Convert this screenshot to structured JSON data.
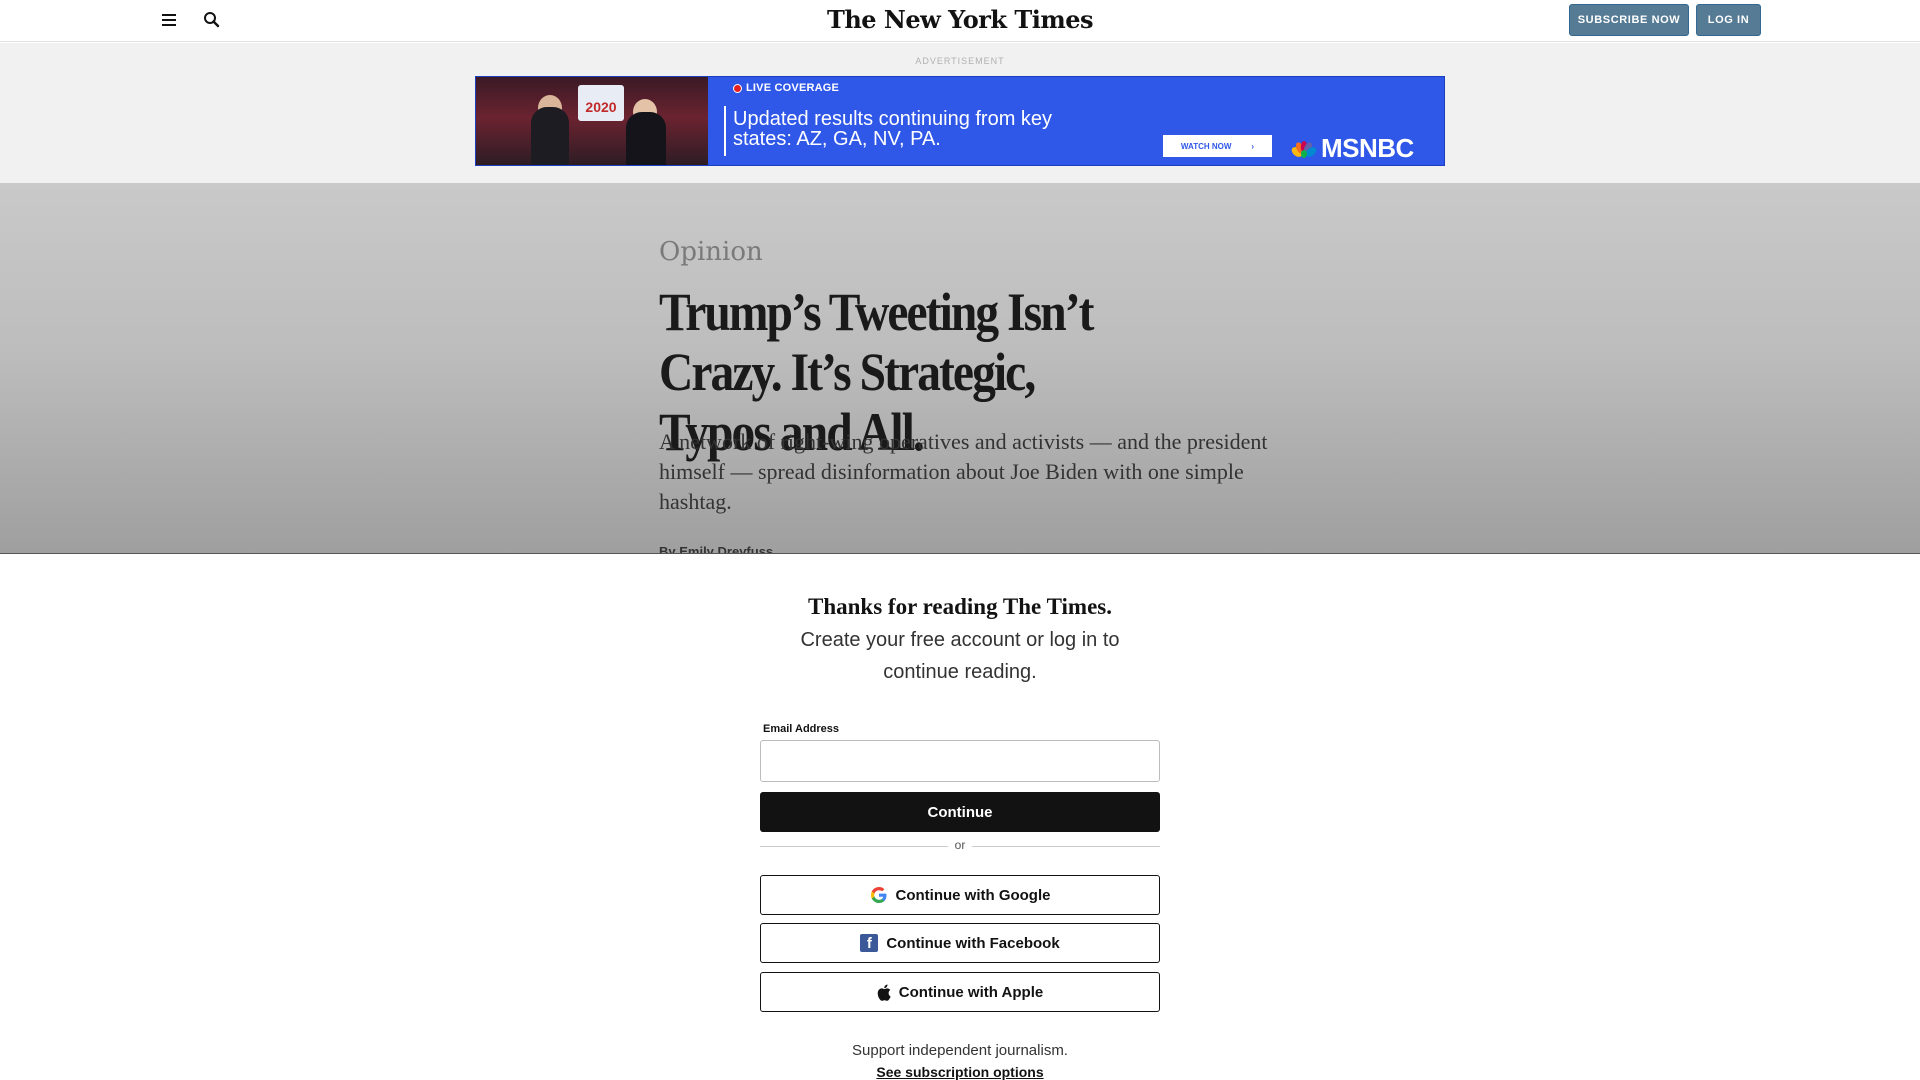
{
  "header": {
    "logo": "The New York Times",
    "subscribe_label": "SUBSCRIBE NOW",
    "login_label": "LOG IN",
    "icons": [
      "menu-icon",
      "search-icon"
    ]
  },
  "ad": {
    "label": "ADVERTISEMENT",
    "live_label": "LIVE COVERAGE",
    "headline": "Updated results continuing from key states: AZ, GA, NV, PA.",
    "watch_label": "WATCH NOW",
    "brand": "MSNBC",
    "photo_sign": "2020",
    "bg_color": "#2f57e8"
  },
  "article": {
    "kicker": "Opinion",
    "headline": "Trump’s Tweeting Isn’t Crazy. It’s Strategic, Typos and All.",
    "summary": "A network of right-wing operatives and activists — and the president himself — spread disinformation about Joe Biden with one simple hashtag.",
    "byline": "By Emily Dreyfuss"
  },
  "modal": {
    "title": "Thanks for reading The Times.",
    "subtitle": "Create your free account or log in to continue reading.",
    "email_label": "Email Address",
    "email_value": "",
    "continue_label": "Continue",
    "or_label": "or",
    "google_label": "Continue with Google",
    "facebook_label": "Continue with Facebook",
    "apple_label": "Continue with Apple",
    "support_text": "Support independent journalism.",
    "subscription_link": "See subscription options"
  }
}
